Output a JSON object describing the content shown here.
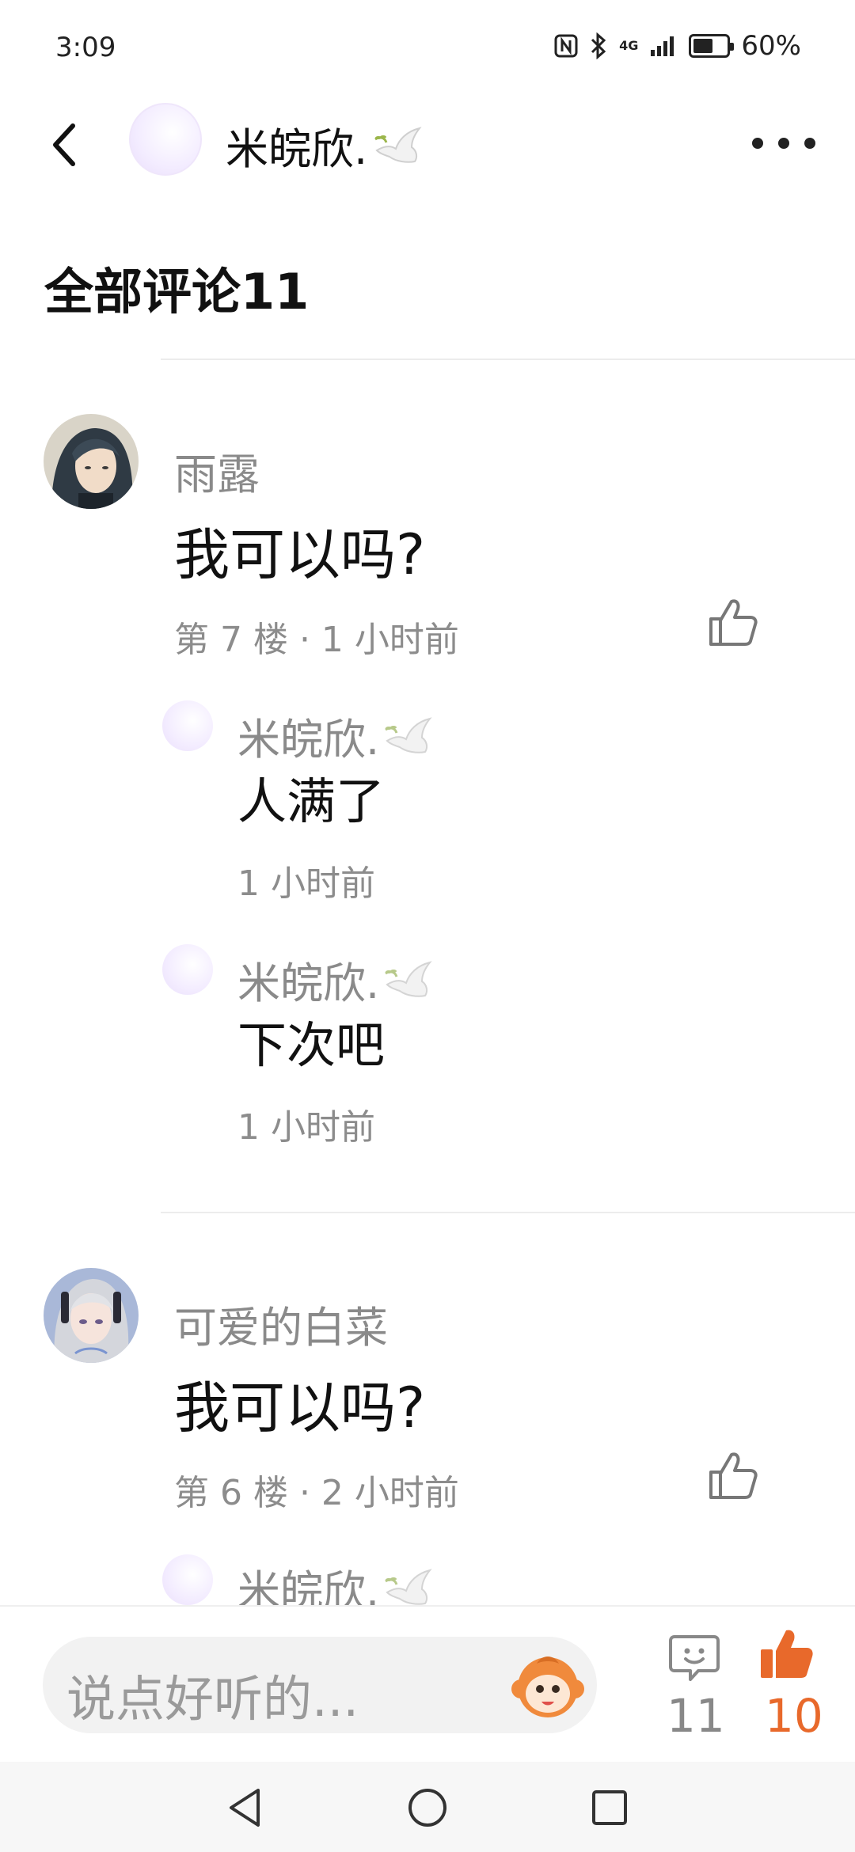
{
  "status_bar": {
    "time": "3:09",
    "network_label": "4G",
    "battery_percent": "60%",
    "battery_level": 0.6
  },
  "header": {
    "username": "米皖欣."
  },
  "section": {
    "title": "全部评论11"
  },
  "comments": [
    {
      "user": "雨露",
      "text": "我可以吗?",
      "meta": "第 7 楼 · 1 小时前",
      "replies": [
        {
          "user": "米皖欣.",
          "text": "人满了",
          "time": "1 小时前"
        },
        {
          "user": "米皖欣.",
          "text": "下次吧",
          "time": "1 小时前"
        }
      ]
    },
    {
      "user": "可爱的白菜",
      "text": "我可以吗?",
      "meta": "第 6 楼 · 2 小时前",
      "replies": [
        {
          "user": "米皖欣."
        }
      ]
    }
  ],
  "bottom_bar": {
    "placeholder": "说点好听的...",
    "comment_count": "11",
    "like_count": "10"
  },
  "colors": {
    "accent": "#e8692b",
    "muted_text": "#8a8a8a"
  }
}
